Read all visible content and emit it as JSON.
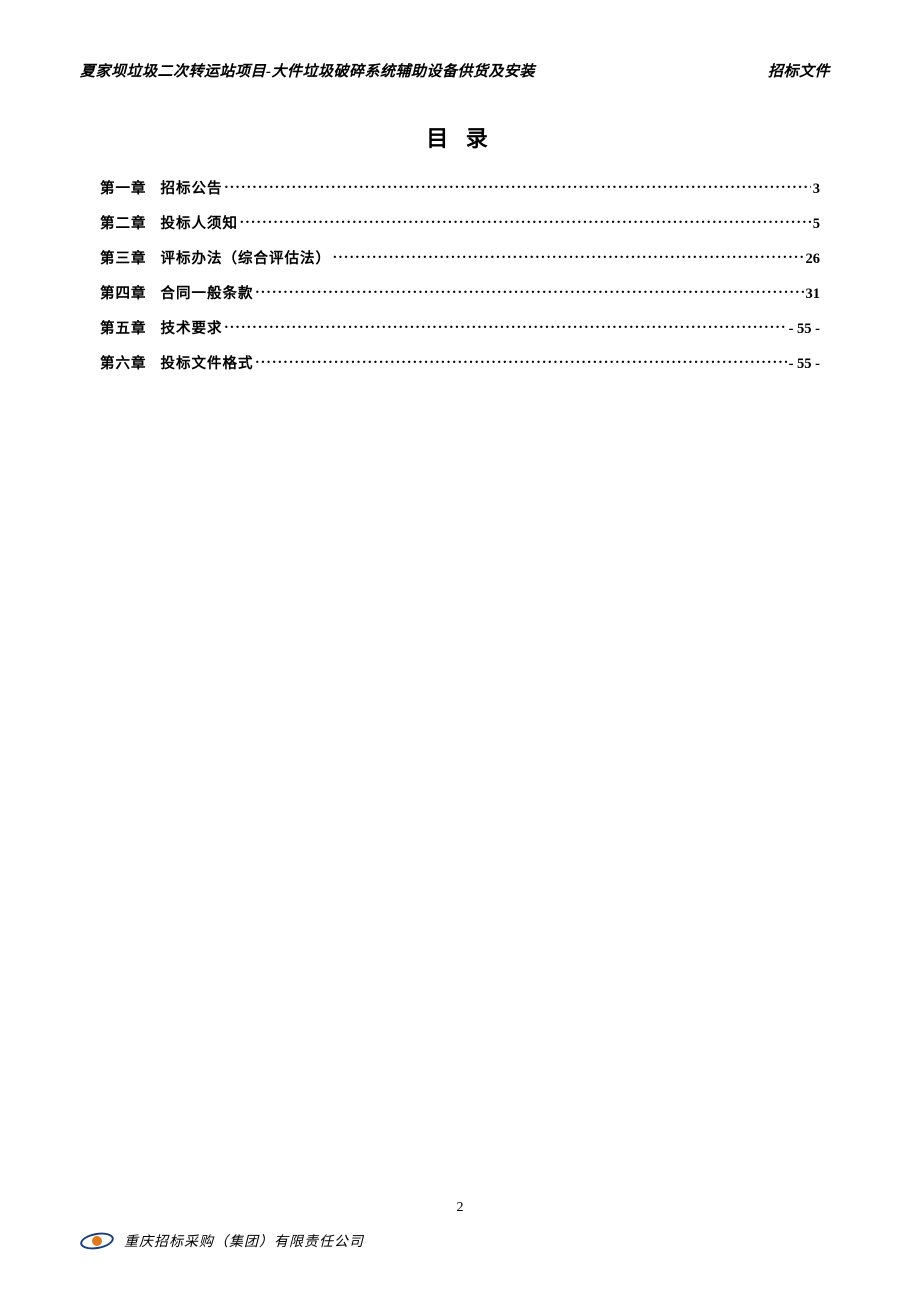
{
  "header": {
    "left": "夏家坝垃圾二次转运站项目-大件垃圾破碎系统辅助设备供货及安装",
    "right": "招标文件"
  },
  "title": "目 录",
  "toc": [
    {
      "chapter": "第一章",
      "label": "招标公告",
      "page": "3"
    },
    {
      "chapter": "第二章",
      "label": "投标人须知",
      "page": "5"
    },
    {
      "chapter": "第三章",
      "label": "评标办法（综合评估法）",
      "page": "26"
    },
    {
      "chapter": "第四章",
      "label": "合同一般条款",
      "page": "31"
    },
    {
      "chapter": "第五章",
      "label": "技术要求",
      "page": "- 55 -"
    },
    {
      "chapter": "第六章",
      "label": "投标文件格式",
      "page": "- 55 -"
    }
  ],
  "footer": {
    "company": "重庆招标采购（集团）有限责任公司",
    "page_number": "2"
  }
}
